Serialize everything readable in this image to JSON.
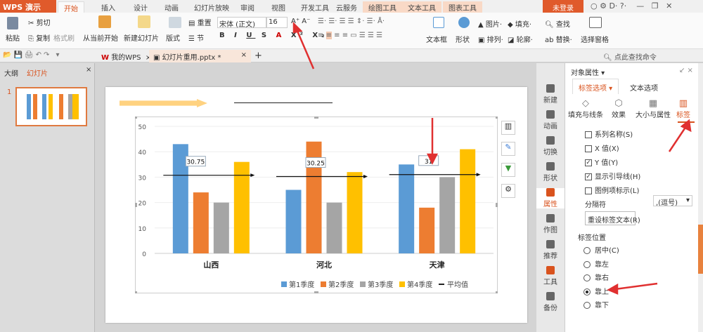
{
  "app": {
    "logo": "WPS 演示",
    "login": "未登录",
    "window_controls": [
      "?",
      "—",
      "❐",
      "✕"
    ]
  },
  "menu_tabs": [
    "开始",
    "插入",
    "设计",
    "动画",
    "幻灯片放映",
    "审阅",
    "视图",
    "开发工具",
    "云服务",
    "绘图工具",
    "文本工具",
    "图表工具"
  ],
  "ribbon": {
    "paste": "粘贴",
    "cut": "剪切",
    "copy": "复制",
    "format_painter": "格式刷",
    "from_current": "从当前开始",
    "new_slide": "新建幻灯片",
    "layout": "版式",
    "reset": "重置",
    "section": "节",
    "font": "宋体 (正文)",
    "font_size": "16",
    "textbox": "文本框",
    "shape": "形状",
    "picture": "图片",
    "fill": "填充",
    "arrange": "排列",
    "outline": "轮廓",
    "find": "查找",
    "replace": "替换",
    "select_pane": "选择窗格",
    "search_cmd": "点此查找命令"
  },
  "doc_tabs": [
    {
      "label": "我的WPS"
    },
    {
      "label": "幻灯片重用.pptx *"
    }
  ],
  "left_panel": {
    "tabs": [
      "大纲",
      "幻灯片"
    ],
    "slide_number": "1"
  },
  "side_icons": [
    "新建",
    "动画",
    "切换",
    "形状",
    "属性",
    "作图",
    "推荐",
    "工具",
    "备份"
  ],
  "panel": {
    "title": "对象属性",
    "tabs": [
      "标签选项",
      "文本选项"
    ],
    "subtabs": [
      "填充与线条",
      "效果",
      "大小与属性",
      "标签"
    ],
    "checkboxes": [
      {
        "label": "系列名称(S)",
        "checked": false
      },
      {
        "label": "X 值(X)",
        "checked": false
      },
      {
        "label": "Y 值(Y)",
        "checked": true
      },
      {
        "label": "显示引导线(H)",
        "checked": true
      },
      {
        "label": "图例项标示(L)",
        "checked": false
      }
    ],
    "separator_label": "分隔符",
    "separator_value": ",(逗号)",
    "reset_button": "重设标签文本(R)",
    "position_label": "标签位置",
    "positions": [
      {
        "label": "居中(C)",
        "selected": false
      },
      {
        "label": "靠左",
        "selected": false
      },
      {
        "label": "靠右",
        "selected": false
      },
      {
        "label": "靠上",
        "selected": true
      },
      {
        "label": "靠下",
        "selected": false
      }
    ]
  },
  "chart_data": {
    "type": "bar",
    "categories": [
      "山西",
      "河北",
      "天津"
    ],
    "series": [
      {
        "name": "第1季度",
        "values": [
          43,
          25,
          35
        ],
        "color": "#5b9bd5"
      },
      {
        "name": "第2季度",
        "values": [
          24,
          44,
          18
        ],
        "color": "#ed7d31"
      },
      {
        "name": "第3季度",
        "values": [
          20,
          20,
          30
        ],
        "color": "#a5a5a5"
      },
      {
        "name": "第4季度",
        "values": [
          36,
          32,
          41
        ],
        "color": "#ffc000"
      }
    ],
    "average": {
      "name": "平均值",
      "values": [
        30.75,
        30.25,
        31
      ],
      "labels": [
        "30.75",
        "30.25",
        "31"
      ]
    },
    "ylim": [
      0,
      50
    ],
    "yticks": [
      "0",
      "10",
      "20",
      "30",
      "40",
      "50"
    ],
    "grid": true,
    "legend": "bottom-right"
  },
  "accent": "#e05a2b"
}
